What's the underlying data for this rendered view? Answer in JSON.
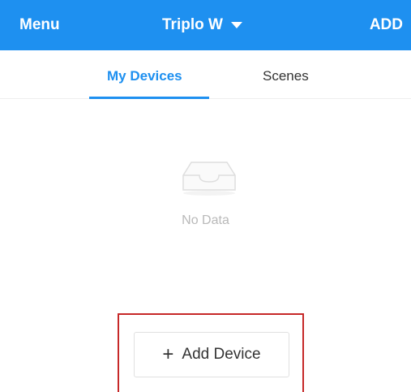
{
  "header": {
    "menu_label": "Menu",
    "home_name": "Triplo W",
    "add_label": "ADD",
    "background_color": "#1e90f0"
  },
  "tabs": [
    {
      "label": "My Devices",
      "active": true
    },
    {
      "label": "Scenes",
      "active": false
    }
  ],
  "empty_state": {
    "icon": "empty-inbox-icon",
    "message": "No Data"
  },
  "add_device": {
    "icon": "plus-icon",
    "icon_glyph": "+",
    "label": "Add Device"
  },
  "colors": {
    "accent": "#1e90f0",
    "highlight": "#c62828"
  }
}
